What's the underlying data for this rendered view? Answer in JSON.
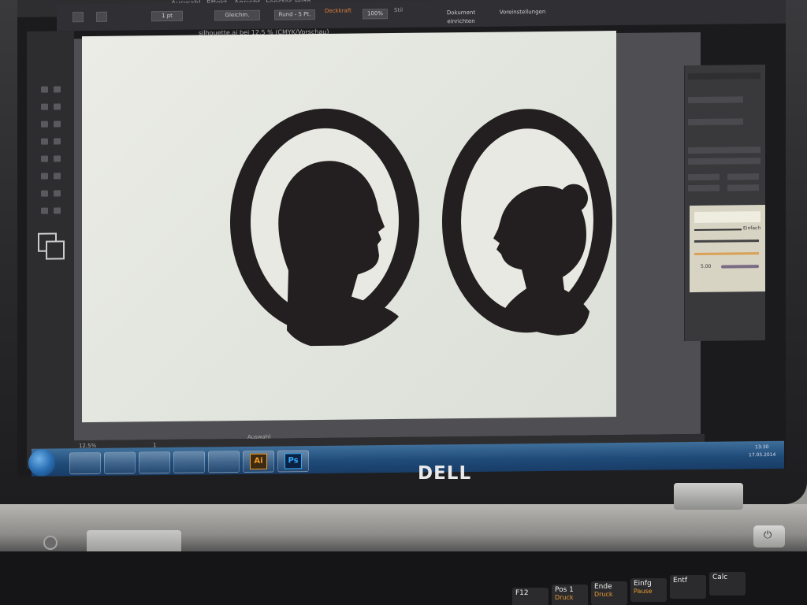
{
  "menus": [
    "Auswahl",
    "Effekt",
    "Ansicht",
    "Fenster",
    "Hilfe"
  ],
  "toolbar_controls": {
    "stroke_weight": "1 pt",
    "stroke_style": "Gleichm.",
    "brush": "Rund - 5 Pt.",
    "opacity_label": "Deckkraft",
    "opacity_value": "100%",
    "style_label": "Stil",
    "doc_setup": "Dokument einrichten",
    "preferences": "Voreinstellungen"
  },
  "document_tab": "silhouette.ai bei 12,5 % (CMYK/Vorschau)",
  "status": {
    "zoom": "12,5%",
    "artboard": "1",
    "tool": "Auswahl"
  },
  "stroke_panel": {
    "basic_label": "Einfach",
    "size_value": "5,00"
  },
  "taskbar": {
    "apps": [
      "ie-icon",
      "explorer-icon",
      "media-player-icon",
      "firefox-icon",
      "cmd-icon",
      "illustrator-icon",
      "photoshop-icon"
    ],
    "ai_label": "Ai",
    "ps_label": "Ps",
    "clock_time": "13:30",
    "clock_date": "17.05.2014"
  },
  "brand": "DELL",
  "keys": [
    {
      "label": "F12",
      "sub": ""
    },
    {
      "label": "Pos 1",
      "sub": "Druck"
    },
    {
      "label": "Ende",
      "sub": "Druck"
    },
    {
      "label": "Einfg",
      "sub": "Pause"
    },
    {
      "label": "Entf",
      "sub": ""
    },
    {
      "label": "Calc",
      "sub": ""
    }
  ],
  "colors": {
    "silhouette": "#231e1f",
    "artboard": "#e8e9e3",
    "accent_ai": "#f59a23",
    "accent_ps": "#31a8ff"
  }
}
